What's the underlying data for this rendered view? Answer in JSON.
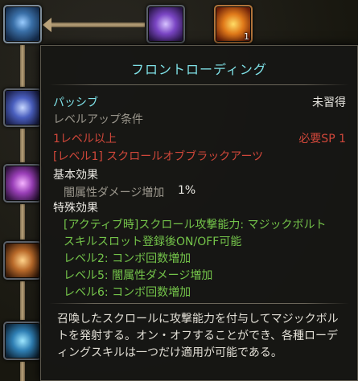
{
  "skill_tree": {
    "nodes": [
      {
        "name": "skill-node-1",
        "level": ""
      },
      {
        "name": "skill-node-2",
        "level": ""
      },
      {
        "name": "skill-node-3",
        "level": "1"
      }
    ]
  },
  "tooltip": {
    "skill_name": "フロントローディング",
    "type": "パッシブ",
    "status": "未習得",
    "req_header": "レベルアップ条件",
    "req_level": "1レベル以上",
    "req_sp": "必要SP 1",
    "req_skill": "[レベル1] スクロールオブブラックアーツ",
    "base_header": "基本効果",
    "base_effect_label": "闇属性ダメージ増加",
    "base_effect_value": "1%",
    "special_header": "特殊効果",
    "special_effects": [
      "[アクティブ時]スクロール攻撃能力: マジックボルト",
      "スキルスロット登録後ON/OFF可能",
      "レベル2: コンボ回数増加",
      "レベル5: 闇属性ダメージ増加",
      "レベル6: コンボ回数増加"
    ],
    "description": "召喚したスクロールに攻撃能力を付与してマジックボルトを発射する。オン・オフすることができ、各種ローディングスキルは一つだけ適用が可能である。"
  },
  "colors": {
    "title": "#7fe1e7",
    "requirement_unmet": "#d0473a",
    "special_effect": "#74c44a",
    "muted": "#9b978d"
  }
}
